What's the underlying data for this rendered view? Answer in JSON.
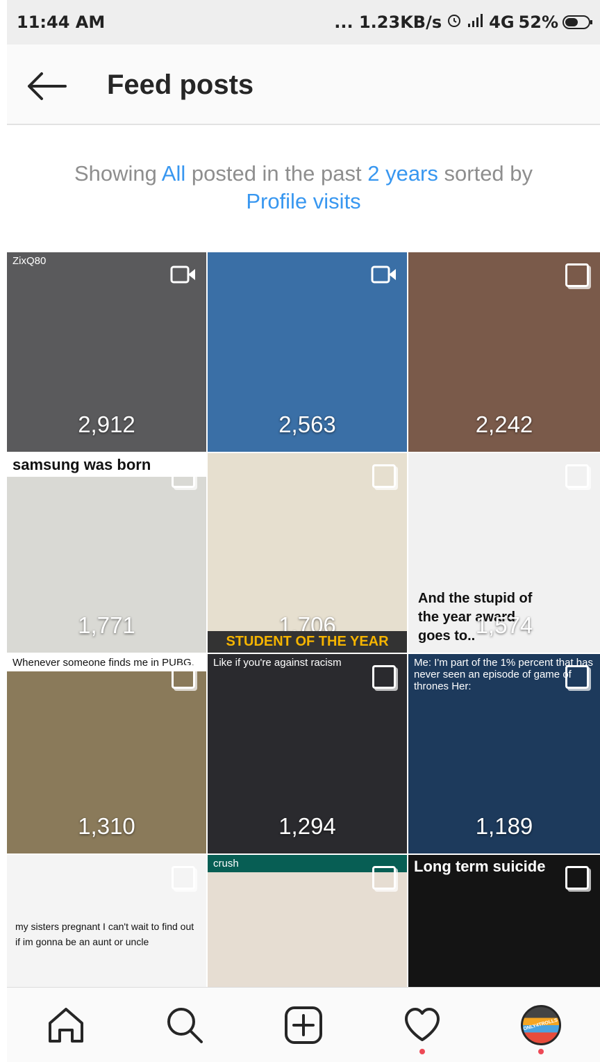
{
  "status_bar": {
    "time": "11:44 AM",
    "network_speed": "... 1.23KB/s",
    "network_type": "4G",
    "battery": "52%"
  },
  "header": {
    "title": "Feed posts",
    "back_icon": "arrow-left-icon"
  },
  "filter": {
    "prefix": "Showing",
    "type": "All",
    "middle": "posted in the past",
    "period": "2 years",
    "sorted_by_text": "sorted by",
    "sort": "Profile visits"
  },
  "posts": [
    {
      "count": "2,912",
      "media": "video",
      "caption": "ZixQ80",
      "bg": "#5a5a5c"
    },
    {
      "count": "2,563",
      "media": "video",
      "caption": "",
      "bg": "#3a6fa6"
    },
    {
      "count": "2,242",
      "media": "photo",
      "caption": "",
      "bg": "#7a5a4a"
    },
    {
      "count": "1,771",
      "media": "photo",
      "caption": "samsung was born",
      "bg": "#d9d9d4"
    },
    {
      "count": "1,706",
      "media": "photo",
      "caption": "STUDENT OF THE YEAR",
      "bg": "#e6dfcf"
    },
    {
      "count": "1,574",
      "media": "photo",
      "caption": "And the stupid of the year award goes to..",
      "bg": "#f1f1f1"
    },
    {
      "count": "1,310",
      "media": "photo",
      "caption": "Whenever someone finds me in PUBG.",
      "bg": "#8a7a5a"
    },
    {
      "count": "1,294",
      "media": "photo",
      "caption": "Like if you're against racism",
      "bg": "#2a2a2e"
    },
    {
      "count": "1,189",
      "media": "photo",
      "caption": "Me: I'm part of the 1% percent that has never seen an episode of game of thrones Her:",
      "bg": "#1d3a5c"
    },
    {
      "count": "",
      "media": "photo",
      "caption": "my sisters pregnant I can't wait to find out if im gonna be an aunt or uncle",
      "bg": "#f4f4f4"
    },
    {
      "count": "",
      "media": "photo",
      "caption": "crush",
      "bg": "#e6ddd2"
    },
    {
      "count": "",
      "media": "photo",
      "caption": "Long term suicide",
      "bg": "#141414"
    }
  ],
  "bottom_nav": [
    {
      "name": "home-icon",
      "badge": false
    },
    {
      "name": "search-icon",
      "badge": false
    },
    {
      "name": "add-post-icon",
      "badge": false
    },
    {
      "name": "heart-icon",
      "badge": true
    },
    {
      "name": "profile-avatar",
      "badge": true,
      "label": "ONLY4TROLLS"
    }
  ],
  "colors": {
    "link": "#3897f0",
    "muted_text": "#8e8e8e",
    "notification_dot": "#ed4956"
  }
}
